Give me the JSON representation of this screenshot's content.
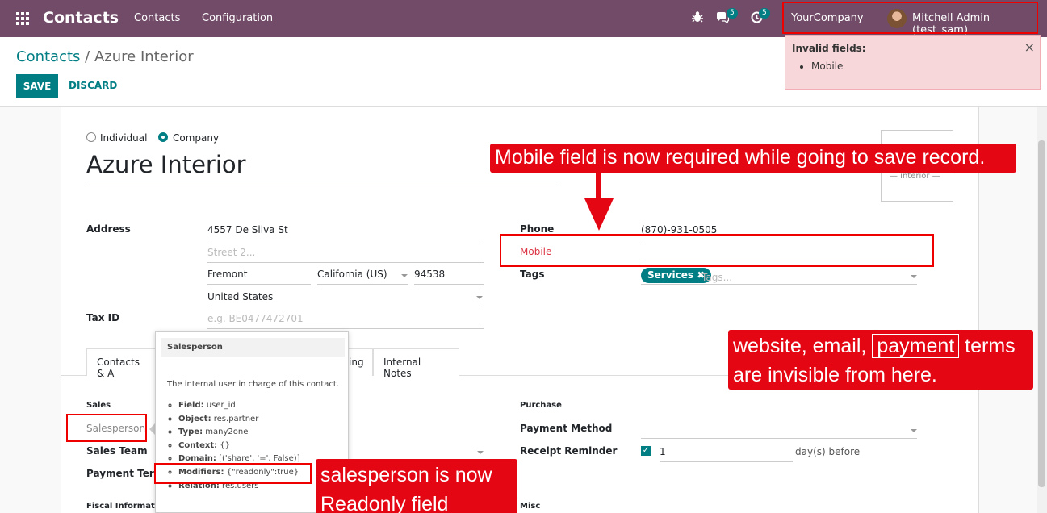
{
  "navbar": {
    "app_title": "Contacts",
    "menu": [
      "Contacts",
      "Configuration"
    ],
    "chat_badge": "5",
    "activity_badge": "5",
    "company": "YourCompany",
    "user": "Mitchell Admin (test_sam)"
  },
  "breadcrumb": {
    "parent": "Contacts",
    "separator": "/",
    "current": "Azure Interior"
  },
  "buttons": {
    "save": "SAVE",
    "discard": "DISCARD"
  },
  "notification": {
    "title": "Invalid fields:",
    "items": [
      "Mobile"
    ],
    "close": "×"
  },
  "form": {
    "type_options": [
      "Individual",
      "Company"
    ],
    "selected_type": "Company",
    "name": "Azure Interior",
    "logo_text": "— interior —",
    "labels": {
      "address": "Address",
      "tax_id": "Tax ID",
      "phone": "Phone",
      "mobile": "Mobile",
      "tags": "Tags"
    },
    "street": "4557 De Silva St",
    "street2_placeholder": "Street 2...",
    "city": "Fremont",
    "state": "California (US)",
    "zip": "94538",
    "country": "United States",
    "vat_placeholder": "e.g. BE0477472701",
    "phone": "(870)-931-0505",
    "mobile": "",
    "tag": "Services",
    "tags_placeholder": "Tags..."
  },
  "tabs": [
    "Contacts & A",
    "ing",
    "Internal Notes"
  ],
  "sales_purchase": {
    "sales_section": "Sales",
    "salesperson": "Salesperson",
    "sales_team": "Sales Team",
    "payment_terms": "Payment Term",
    "purchase_section": "Purchase",
    "payment_method": "Payment Method",
    "receipt_reminder": "Receipt Reminder",
    "reminder_days": "1",
    "days_before": "day(s) before",
    "fiscal_section": "Fiscal Information",
    "misc_section": "Misc"
  },
  "tooltip": {
    "title": "Salesperson",
    "description": "The internal user in charge of this contact.",
    "field_key": "Field:",
    "field_val": "user_id",
    "object_key": "Object:",
    "object_val": "res.partner",
    "type_key": "Type:",
    "type_val": "many2one",
    "context_key": "Context:",
    "context_val": "{}",
    "domain_key": "Domain:",
    "domain_val": "[('share', '=', False)]",
    "modifiers_key": "Modifiers:",
    "modifiers_val": "{\"readonly\":true}",
    "relation_key": "Relation:",
    "relation_val": "res.users"
  },
  "annotations": {
    "mobile_note": "Mobile field is now required while going to save record.",
    "invisible_note_line1a": "website, email,",
    "invisible_note_line1b": "payment",
    "invisible_note_line1c": "terms",
    "invisible_note_line2": "are invisible from here.",
    "readonly_note_line1": "salesperson is now",
    "readonly_note_line2": "Readonly field"
  },
  "colors": {
    "navbar": "#714B67",
    "primary": "#017e84",
    "annotation": "#e40613",
    "error_bg": "#f8d7da"
  }
}
